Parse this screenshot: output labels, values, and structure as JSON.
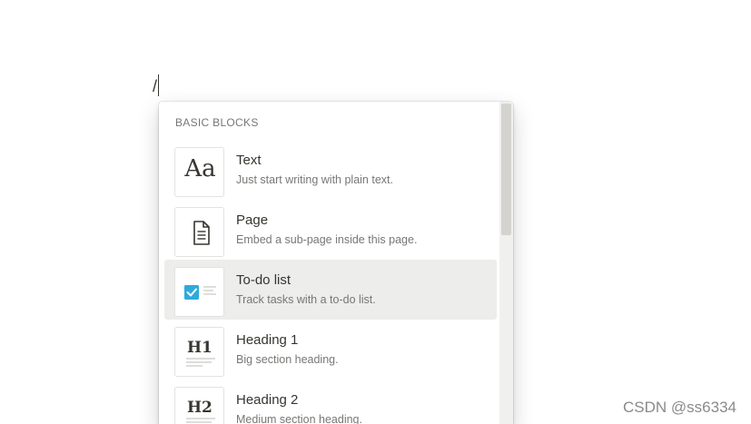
{
  "editor": {
    "typed_text": "/"
  },
  "menu": {
    "section_title": "BASIC BLOCKS",
    "items": [
      {
        "title": "Text",
        "description": "Just start writing with plain text.",
        "icon": "text-aa-icon",
        "thumb_label": "Aa"
      },
      {
        "title": "Page",
        "description": "Embed a sub-page inside this page.",
        "icon": "page-document-icon"
      },
      {
        "title": "To-do list",
        "description": "Track tasks with a to-do list.",
        "icon": "todo-checkbox-icon",
        "selected": true
      },
      {
        "title": "Heading 1",
        "description": "Big section heading.",
        "icon": "heading-1-icon",
        "thumb_label": "H1"
      },
      {
        "title": "Heading 2",
        "description": "Medium section heading.",
        "icon": "heading-2-icon",
        "thumb_label": "H2"
      }
    ]
  },
  "watermark": "CSDN @ss6334",
  "colors": {
    "checkbox_blue": "#2eaadc",
    "selected_bg": "#ededec",
    "text_primary": "#37352f",
    "text_secondary": "#787774"
  }
}
